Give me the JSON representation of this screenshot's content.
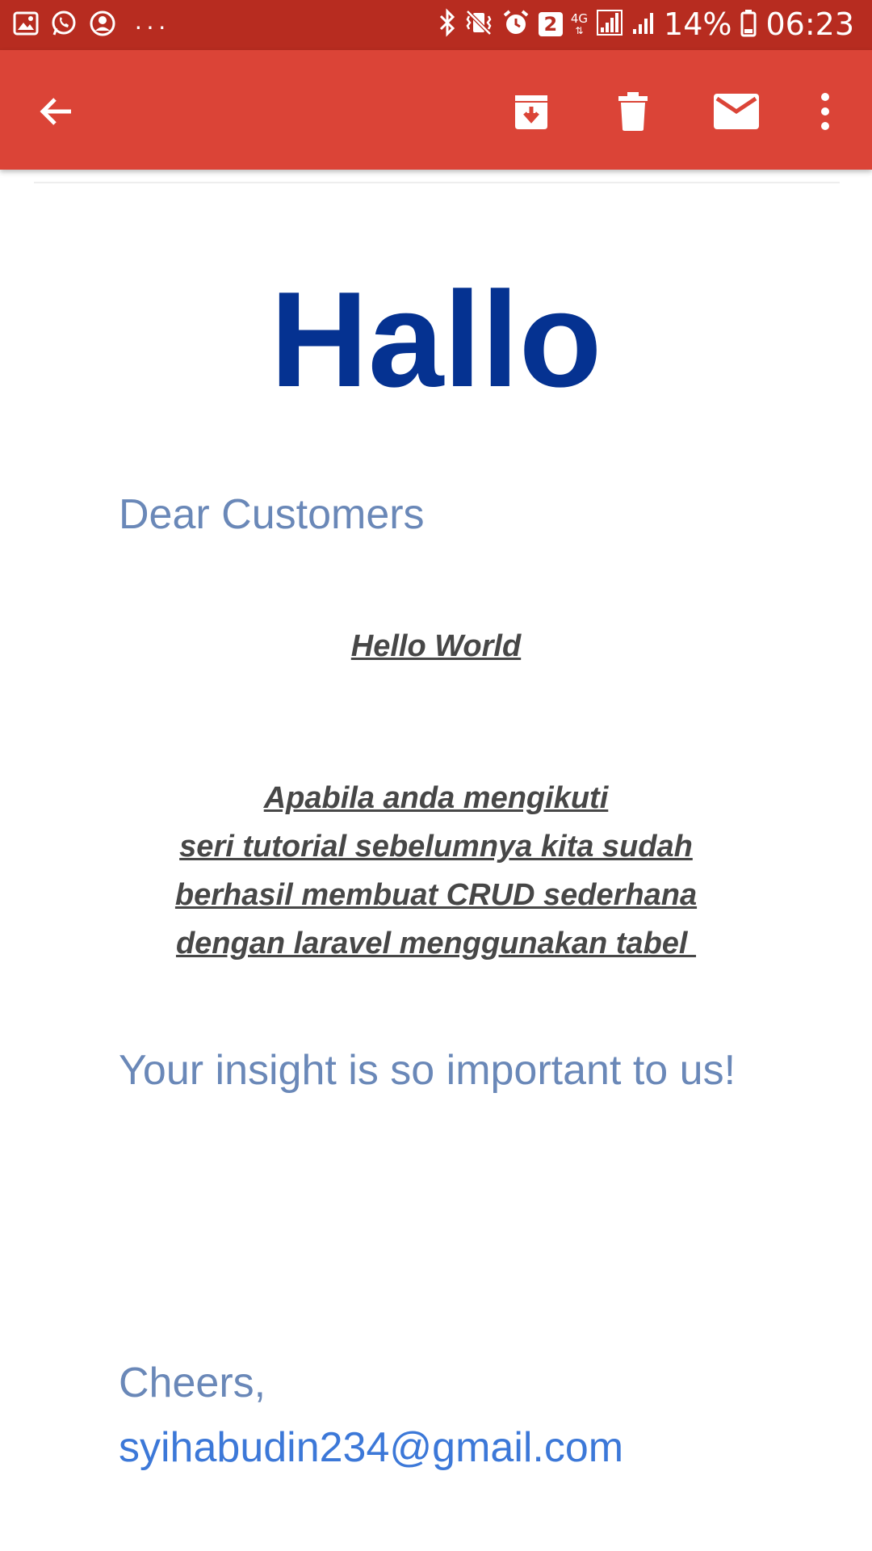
{
  "status_bar": {
    "left_icons": [
      "gallery-icon",
      "whatsapp-icon",
      "account-icon"
    ],
    "more_dots": "···",
    "right_icons": [
      "bluetooth-icon",
      "vibrate-icon",
      "alarm-icon",
      "sim-2-icon",
      "4g-icon",
      "signal-icon",
      "signal-icon-2",
      "battery-icon"
    ],
    "sim_number": "2",
    "network": "4G",
    "battery": "14%",
    "time": "06:23"
  },
  "toolbar": {
    "icons": [
      "back-arrow-icon",
      "archive-icon",
      "delete-icon",
      "mark-unread-icon",
      "more-vert-icon"
    ],
    "background": "#db4437",
    "status_background": "#b72c20"
  },
  "email": {
    "heading": "Hallo",
    "greeting": "Dear Customers",
    "hello_world": "Hello World",
    "paragraph_lines": [
      "Apabila anda mengikuti",
      "seri tutorial sebelumnya kita sudah",
      "berhasil membuat CRUD sederhana",
      "dengan laravel menggunakan tabel "
    ],
    "insight": "Your insight is so important to us!",
    "closing": "Cheers,",
    "sender_email": "syihabudin234@gmail.com",
    "heading_color": "#053291",
    "text_color": "#6a88b8",
    "link_color": "#3c78d8"
  }
}
